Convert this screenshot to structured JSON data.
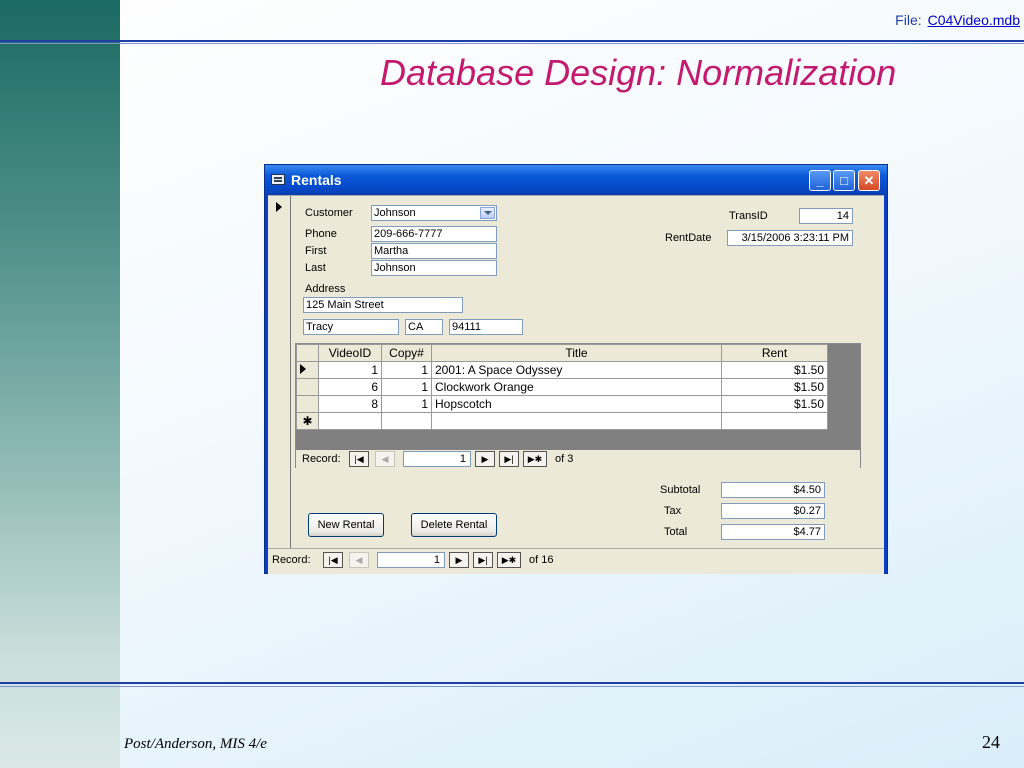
{
  "slide": {
    "file_label": "File:",
    "file_link": "C04Video.mdb",
    "title": "Database Design:  Normalization",
    "footer_left": "Post/Anderson, MIS 4/e",
    "page_number": "24"
  },
  "window": {
    "title": "Rentals",
    "min_glyph": "_",
    "max_glyph": "□",
    "close_glyph": "✕"
  },
  "form": {
    "customer_label": "Customer",
    "customer_value": "Johnson",
    "phone_label": "Phone",
    "phone_value": "209-666-7777",
    "first_label": "First",
    "first_value": "Martha",
    "last_label": "Last",
    "last_value": "Johnson",
    "address_label": "Address",
    "address_value": "125 Main Street",
    "city_value": "Tracy",
    "state_value": "CA",
    "zip_value": "94111",
    "transid_label": "TransID",
    "transid_value": "14",
    "rentdate_label": "RentDate",
    "rentdate_value": "3/15/2006 3:23:11 PM"
  },
  "subform": {
    "columns": [
      "VideoID",
      "Copy#",
      "Title",
      "Rent"
    ],
    "rows": [
      {
        "videoid": "1",
        "copy": "1",
        "title": "2001:  A Space Odyssey",
        "rent": "$1.50"
      },
      {
        "videoid": "6",
        "copy": "1",
        "title": "Clockwork Orange",
        "rent": "$1.50"
      },
      {
        "videoid": "8",
        "copy": "1",
        "title": "Hopscotch",
        "rent": "$1.50"
      }
    ],
    "new_row_glyph": "✱",
    "record_label": "Record:",
    "record_current": "1",
    "record_of": "of  3"
  },
  "totals": {
    "subtotal_label": "Subtotal",
    "subtotal_value": "$4.50",
    "tax_label": "Tax",
    "tax_value": "$0.27",
    "total_label": "Total",
    "total_value": "$4.77"
  },
  "buttons": {
    "new_rental": "New Rental",
    "delete_rental": "Delete Rental"
  },
  "main_nav": {
    "record_label": "Record:",
    "record_current": "1",
    "record_of": "of  16"
  },
  "nav_glyphs": {
    "first": "|◀",
    "prev": "◀",
    "next": "▶",
    "last": "▶|",
    "new": "▶✱"
  }
}
